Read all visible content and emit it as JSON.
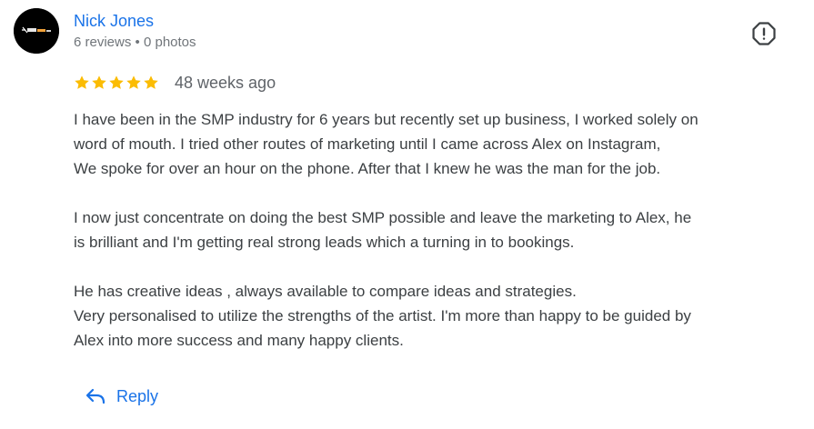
{
  "reviewer": {
    "name": "Nick Jones",
    "reviews_count": "6 reviews",
    "separator": "•",
    "photos_count": "0 photos",
    "avatar_icon": "brand-logo"
  },
  "rating": {
    "stars": 5,
    "max_stars": 5,
    "time_ago": "48 weeks ago"
  },
  "review": {
    "paragraphs": [
      [
        "I have been in the SMP industry for 6 years but recently set up business, I worked solely on",
        "word of mouth. I tried other routes of marketing until I came across Alex on Instagram,",
        "We spoke for over an hour on the phone. After that I knew he was the man for the job."
      ],
      [
        "I now just concentrate on doing the best SMP possible and leave the marketing to Alex, he",
        "is brilliant and I'm getting real strong leads which a turning in to bookings."
      ],
      [
        "He has creative ideas , always available to compare ideas and strategies.",
        "Very personalised to utilize the strengths of the artist. I'm more than happy to be guided by",
        "Alex into more success and many happy clients."
      ]
    ]
  },
  "actions": {
    "reply_label": "Reply",
    "reply_icon": "reply-arrow-icon",
    "report_icon": "report-icon"
  },
  "colors": {
    "link_blue": "#1a73e8",
    "star_gold": "#fbbc04",
    "text": "#3c4043",
    "muted": "#70757a"
  }
}
